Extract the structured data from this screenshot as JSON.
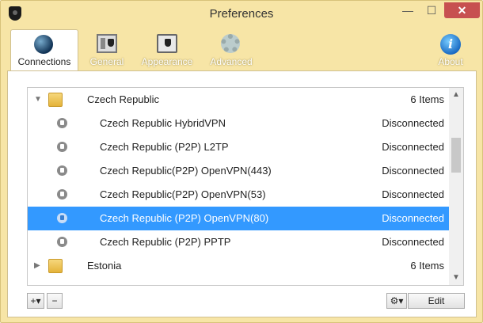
{
  "window": {
    "title": "Preferences",
    "minimize": "—",
    "maximize": "☐",
    "close": "✕"
  },
  "toolbar": {
    "connections": "Connections",
    "general": "General",
    "appearance": "Appearance",
    "advanced": "Advanced",
    "about": "About"
  },
  "groups": [
    {
      "name": "Czech Republic",
      "count": "6 Items",
      "expanded": true
    },
    {
      "name": "Estonia",
      "count": "6 Items",
      "expanded": false
    }
  ],
  "servers": [
    {
      "name": "Czech Republic HybridVPN",
      "status": "Disconnected"
    },
    {
      "name": "Czech Republic (P2P) L2TP",
      "status": "Disconnected"
    },
    {
      "name": "Czech Republic(P2P) OpenVPN(443)",
      "status": "Disconnected"
    },
    {
      "name": "Czech Republic(P2P) OpenVPN(53)",
      "status": "Disconnected"
    },
    {
      "name": "Czech Republic (P2P) OpenVPN(80)",
      "status": "Disconnected"
    },
    {
      "name": "Czech Republic (P2P) PPTP",
      "status": "Disconnected"
    }
  ],
  "buttons": {
    "add": "+▾",
    "remove": "−",
    "settings": "⚙▾",
    "edit": "Edit"
  },
  "icons": {
    "expanded": "▼",
    "collapsed": "▶",
    "scroll_up": "▲",
    "scroll_down": "▼"
  },
  "colors": {
    "selection": "#3399ff",
    "frame": "#f7e5a6"
  }
}
